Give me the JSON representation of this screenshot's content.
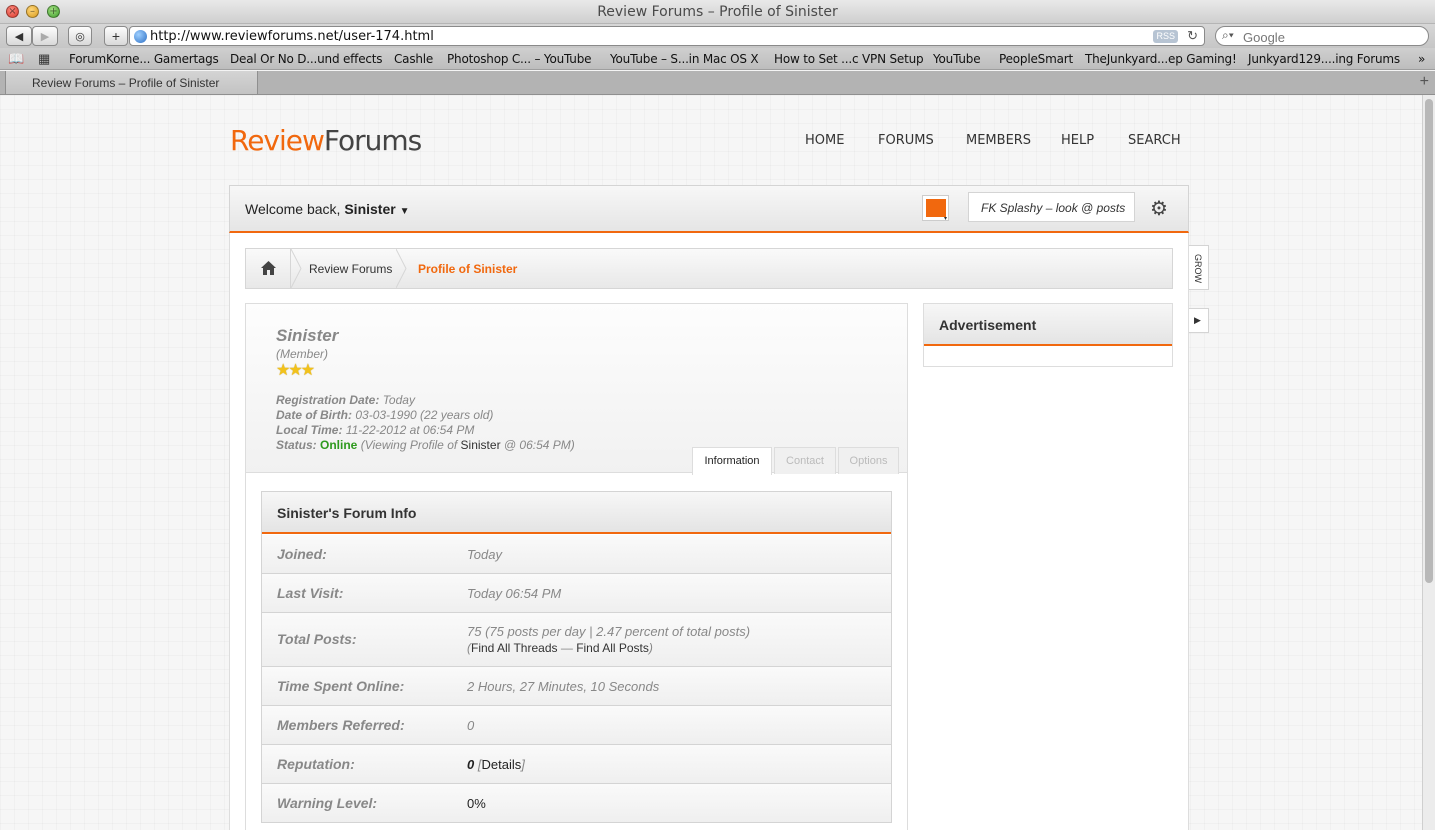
{
  "browser": {
    "window_title": "Review Forums – Profile of Sinister",
    "url": "http://www.reviewforums.net/user-174.html",
    "rss_label": "RSS",
    "search_placeholder": "Google",
    "tab_title": "Review Forums – Profile of Sinister",
    "bookmarks": [
      "ForumKorne... Gamertags",
      "Deal Or No D...und effects",
      "Cashle",
      "Photoshop C... – YouTube",
      "YouTube – S...in Mac OS X",
      "How to Set ...c VPN Setup",
      "YouTube",
      "PeopleSmart",
      "TheJunkyard...ep Gaming!",
      "Junkyard129....ing Forums"
    ]
  },
  "site": {
    "logo_part1": "Review",
    "logo_part2": "Forums",
    "nav": [
      "HOME",
      "FORUMS",
      "MEMBERS",
      "HELP",
      "SEARCH"
    ],
    "welcome_prefix": "Welcome back,",
    "username": "Sinister",
    "shout_text": "FK Splashy – look @ posts",
    "side_tab": "GROW",
    "accent_color": "#f1680e"
  },
  "breadcrumb": {
    "crumb1": "Review Forums",
    "crumb2": "Profile of Sinister"
  },
  "profile": {
    "name": "Sinister",
    "rank": "(Member)",
    "stars": "★★★",
    "registration_label": "Registration Date:",
    "registration_value": "Today",
    "dob_label": "Date of Birth:",
    "dob_value": "03-03-1990 (22 years old)",
    "local_time_label": "Local Time:",
    "local_time_value": "11-22-2012 at 06:54 PM",
    "status_label": "Status:",
    "status_value": "Online",
    "status_detail_pre": "(Viewing Profile of",
    "status_detail_name": "Sinister",
    "status_detail_post": "@ 06:54 PM)",
    "tabs": [
      "Information",
      "Contact",
      "Options"
    ]
  },
  "forum_info": {
    "title": "Sinister's Forum Info",
    "joined_label": "Joined:",
    "joined_value": "Today",
    "last_visit_label": "Last Visit:",
    "last_visit_value": "Today 06:54 PM",
    "total_posts_label": "Total Posts:",
    "total_posts_value": "75 (75 posts per day | 2.47 percent of total posts)",
    "find_threads": "Find All Threads",
    "find_sep": "—",
    "find_posts": "Find All Posts",
    "time_online_label": "Time Spent Online:",
    "time_online_value": "2 Hours, 27 Minutes, 10 Seconds",
    "referred_label": "Members Referred:",
    "referred_value": "0",
    "reputation_label": "Reputation:",
    "reputation_value": "0",
    "reputation_details": "Details",
    "warning_label": "Warning Level:",
    "warning_value": "0%"
  },
  "sidebar": {
    "ad_title": "Advertisement"
  }
}
